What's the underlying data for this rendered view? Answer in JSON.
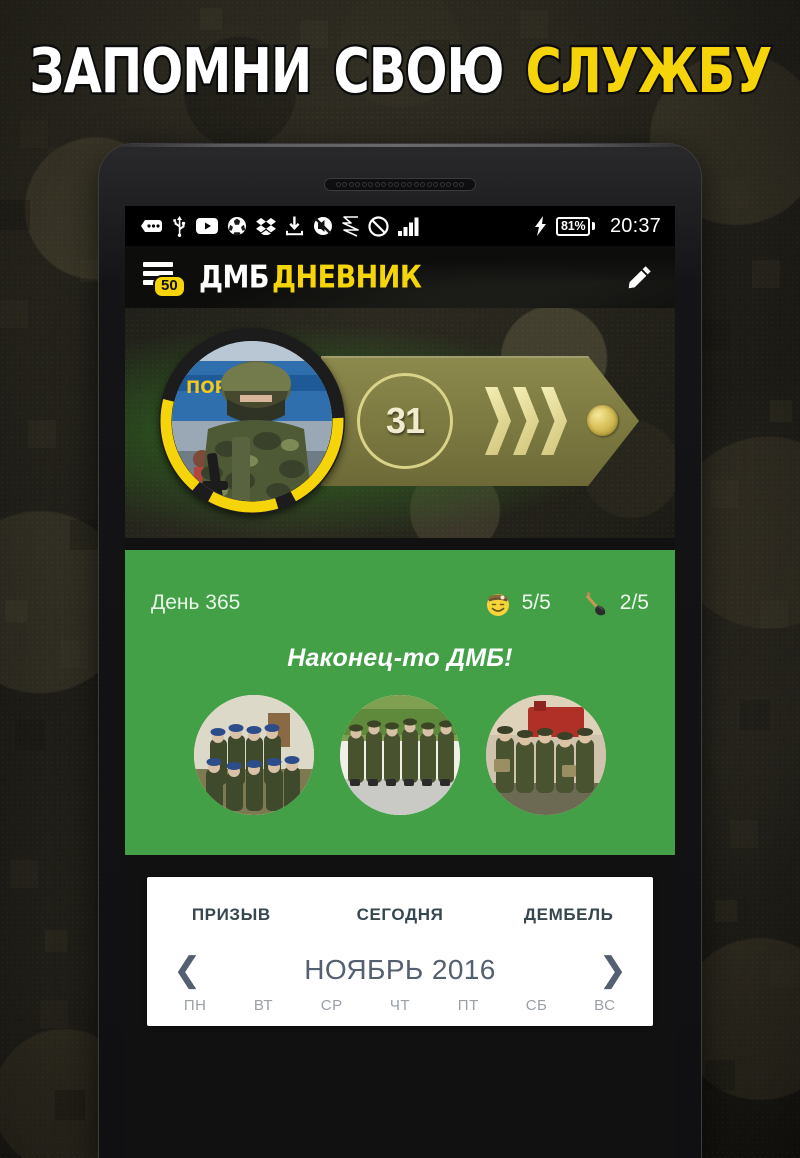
{
  "hero": {
    "word1": "ЗАПОМНИ",
    "word2": "СВОЮ",
    "word3": "СЛУЖБУ",
    "white_color": "#ffffff",
    "accent_color": "#f5d40a"
  },
  "statusbar": {
    "icons": [
      "message-icon",
      "usb-icon",
      "youtube-icon",
      "globe-icon",
      "dropbox-icon",
      "download-icon",
      "mute-icon",
      "s-app-icon",
      "do-not-disturb-icon",
      "signal-bars-icon"
    ],
    "charging_icon": "charging-bolt-icon",
    "battery_percent": "81%",
    "time": "20:37"
  },
  "appbar": {
    "menu_icon": "hamburger-menu-icon",
    "menu_badge": "50",
    "title_part1": "ДМБ",
    "title_part2": "ДНЕВНИК",
    "edit_icon": "pencil-edit-icon"
  },
  "profile": {
    "avatar_alt": "soldier-avatar",
    "level": "31",
    "chevron_count": 3,
    "star_icon": "gold-star-icon",
    "progress_ring_color": "#f5d40a"
  },
  "daycard": {
    "day_label": "День 365",
    "accent_color": "#43a047",
    "stats": [
      {
        "icon": "mood-smiley-icon",
        "value": "5/5"
      },
      {
        "icon": "shovel-icon",
        "value": "2/5"
      }
    ],
    "note": "Наконец-то ДМБ!",
    "photos": [
      "soldiers-group-photo-1",
      "soldiers-marching-photo-2",
      "soldiers-truck-photo-3"
    ]
  },
  "calendar": {
    "tabs": [
      "ПРИЗЫВ",
      "СЕГОДНЯ",
      "ДЕМБЕЛЬ"
    ],
    "prev_icon": "chevron-left-icon",
    "next_icon": "chevron-right-icon",
    "month": "НОЯБРЬ 2016",
    "weekdays": [
      "ПН",
      "ВТ",
      "СР",
      "ЧТ",
      "ПТ",
      "СБ",
      "ВС"
    ]
  }
}
